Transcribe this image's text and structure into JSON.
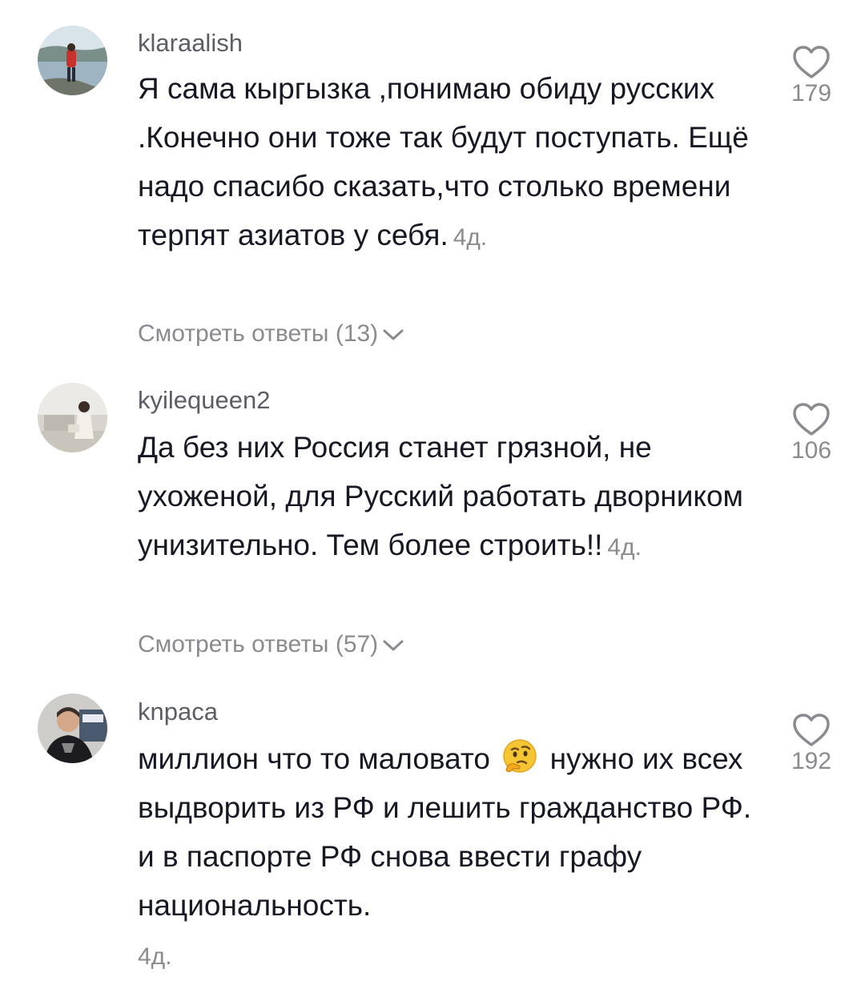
{
  "comments": [
    {
      "username": "klaraalish",
      "text": "Я сама кыргызка ,понимаю обиду русских .Конечно они тоже так будут поступать. Ещё надо спасибо сказать,что столько времени терпят азиатов у себя.",
      "time": "4д.",
      "likes": "179",
      "replies": "Смотреть ответы (13)"
    },
    {
      "username": "kyilequeen2",
      "text": "Да без них Россия станет грязной, не ухоженой, для Русский работать дворником унизительно. Тем более строить!!",
      "time": "4д.",
      "likes": "106",
      "replies": "Смотреть ответы (57)"
    },
    {
      "username": "knpaca",
      "text_before_emoji": "миллион что то маловато",
      "emoji": "thinking-face",
      "text_after_emoji": "нужно их всех выдворить из РФ и лешить гражданство РФ. и в паспорте РФ снова ввести графу национальность.",
      "time": "4д.",
      "likes": "192"
    }
  ],
  "icons": {
    "like": "heart-outline-icon",
    "expand": "chevron-down-icon"
  },
  "colors": {
    "text": "#161823",
    "username": "#5c5e66",
    "secondary": "#8a8b91",
    "background": "#ffffff"
  }
}
